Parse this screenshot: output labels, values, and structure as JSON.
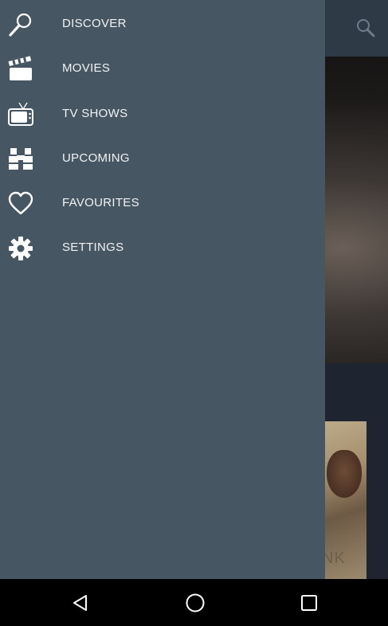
{
  "header": {
    "search_icon": "search-icon"
  },
  "drawer": {
    "items": [
      {
        "label": "DISCOVER",
        "icon": "magnifier-icon"
      },
      {
        "label": "MOVIES",
        "icon": "clapperboard-icon"
      },
      {
        "label": "TV SHOWS",
        "icon": "tv-icon"
      },
      {
        "label": "UPCOMING",
        "icon": "binoculars-icon"
      },
      {
        "label": "FAVOURITES",
        "icon": "heart-icon"
      },
      {
        "label": "SETTINGS",
        "icon": "gear-icon"
      }
    ]
  },
  "poster": {
    "partial_title": "NK"
  },
  "navbar": {
    "buttons": [
      "back-icon",
      "home-icon",
      "recents-icon"
    ]
  },
  "colors": {
    "drawer": "#465663",
    "header": "#2f3a47",
    "background": "#1e2531"
  }
}
